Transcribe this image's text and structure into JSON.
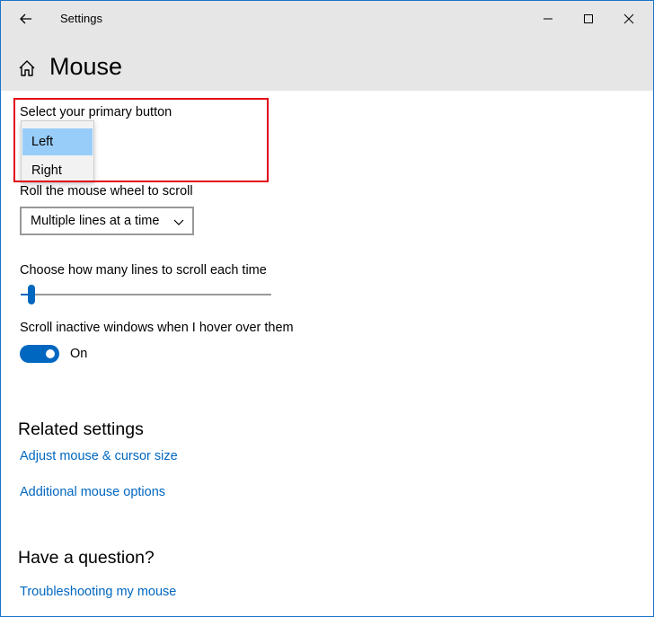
{
  "window": {
    "title": "Settings",
    "controls": [
      "minimize",
      "maximize",
      "close"
    ]
  },
  "page": {
    "title": "Mouse"
  },
  "primary_button": {
    "label": "Select your primary button",
    "options": [
      "Left",
      "Right"
    ],
    "selected": "Left"
  },
  "scroll": {
    "label": "Roll the mouse wheel to scroll",
    "value": "Multiple lines at a time"
  },
  "lines": {
    "label": "Choose how many lines to scroll each time",
    "value_fraction": 0.03
  },
  "inactive": {
    "label": "Scroll inactive windows when I hover over them",
    "state": "On"
  },
  "related": {
    "heading": "Related settings",
    "links": [
      "Adjust mouse & cursor size",
      "Additional mouse options"
    ]
  },
  "question": {
    "heading": "Have a question?",
    "link": "Troubleshooting my mouse"
  },
  "colors": {
    "accent": "#0067c0",
    "titlebar": "#e6e6e6",
    "selected_option": "#99cdf9",
    "highlight": "#e2001a"
  }
}
